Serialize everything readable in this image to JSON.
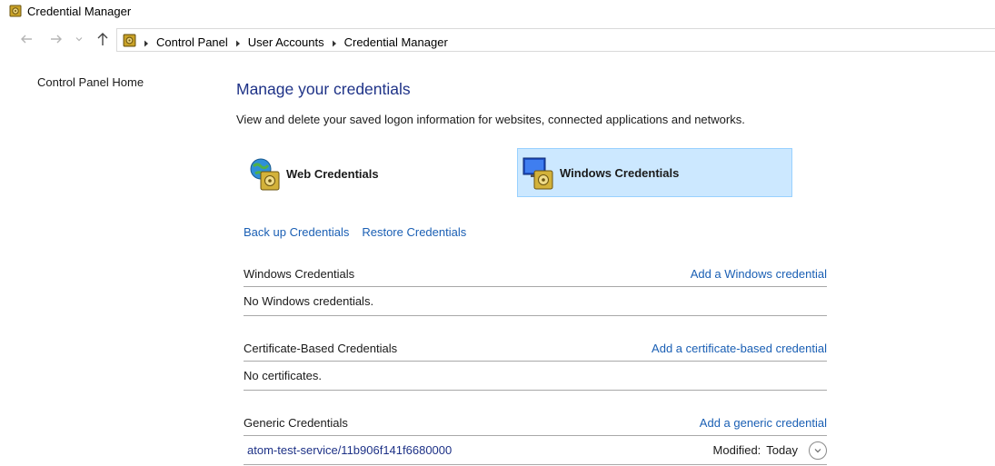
{
  "window": {
    "title": "Credential Manager",
    "icon": "credential-vault-icon"
  },
  "address": {
    "breadcrumbs": [
      "Control Panel",
      "User Accounts",
      "Credential Manager"
    ],
    "icons": [
      "back-arrow-icon",
      "forward-arrow-icon",
      "recent-dropdown-icon",
      "up-arrow-icon",
      "credential-vault-icon"
    ]
  },
  "left_nav": {
    "home_label": "Control Panel Home"
  },
  "main": {
    "title": "Manage your credentials",
    "subtitle": "View and delete your saved logon information for websites, connected applications and networks.",
    "tiles": [
      {
        "label": "Web Credentials",
        "icon": "web-credentials-icon",
        "selected": false
      },
      {
        "label": "Windows Credentials",
        "icon": "windows-credentials-icon",
        "selected": true
      }
    ],
    "actions": {
      "backup": "Back up Credentials",
      "restore": "Restore Credentials"
    },
    "sections": [
      {
        "title": "Windows Credentials",
        "add_link": "Add a Windows credential",
        "empty_text": "No Windows credentials."
      },
      {
        "title": "Certificate-Based Credentials",
        "add_link": "Add a certificate-based credential",
        "empty_text": "No certificates."
      },
      {
        "title": "Generic Credentials",
        "add_link": "Add a generic credential",
        "items": [
          {
            "name": "atom-test-service/11b906f141f6680000",
            "modified_label": "Modified:",
            "modified_value": "Today"
          }
        ]
      }
    ]
  },
  "colors": {
    "link": "#1a5fb4",
    "heading": "#1e3287",
    "selected_tile_bg": "#cce8ff",
    "selected_tile_border": "#99d1ff"
  }
}
